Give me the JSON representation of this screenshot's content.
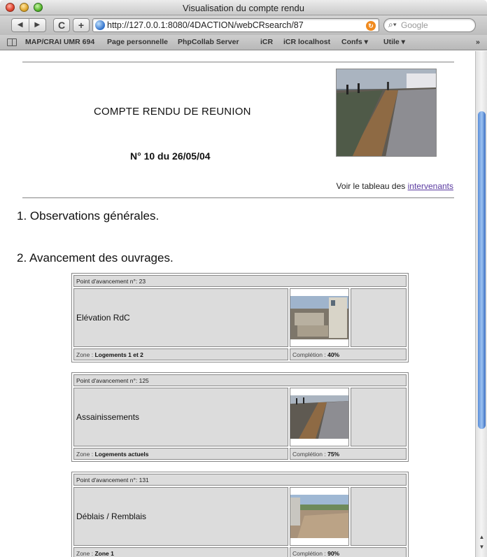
{
  "window": {
    "title": "Visualisation du compte rendu"
  },
  "toolbar": {
    "back_label": "◀",
    "forward_label": "▶",
    "reload_label": "C",
    "add_label": "+",
    "url": "http://127.0.0.1:8080/4DACTION/webCRsearch/87",
    "search_placeholder": "Google"
  },
  "bookmarks": [
    "MAP/CRAI UMR 694",
    "Page personnelle",
    "PhpCollab Server",
    "iCR",
    "iCR localhost",
    "Confs ▾",
    "Utile ▾"
  ],
  "bookmarks_more": "»",
  "page": {
    "title": "COMPTE RENDU DE REUNION",
    "number": "N° 10 du 26/05/04",
    "voir_text": "Voir le tableau des ",
    "voir_link": "intervenants",
    "section1": "1. Observations générales.",
    "section2": "2. Avancement des ouvrages."
  },
  "items": [
    {
      "header": "Point d'avancement n°: 23",
      "name": "Elévation RdC",
      "zone_label": "Zone : ",
      "zone": "Logements 1 et 2",
      "completion_label": "Complétion : ",
      "completion": "40%"
    },
    {
      "header": "Point d'avancement n°: 125",
      "name": "Assainissements",
      "zone_label": "Zone : ",
      "zone": "Logements actuels",
      "completion_label": "Complétion : ",
      "completion": "75%"
    },
    {
      "header": "Point d'avancement n°: 131",
      "name": "Déblais / Remblais",
      "zone_label": "Zone : ",
      "zone": "Zone 1",
      "completion_label": "Complétion : ",
      "completion": "90%"
    }
  ]
}
